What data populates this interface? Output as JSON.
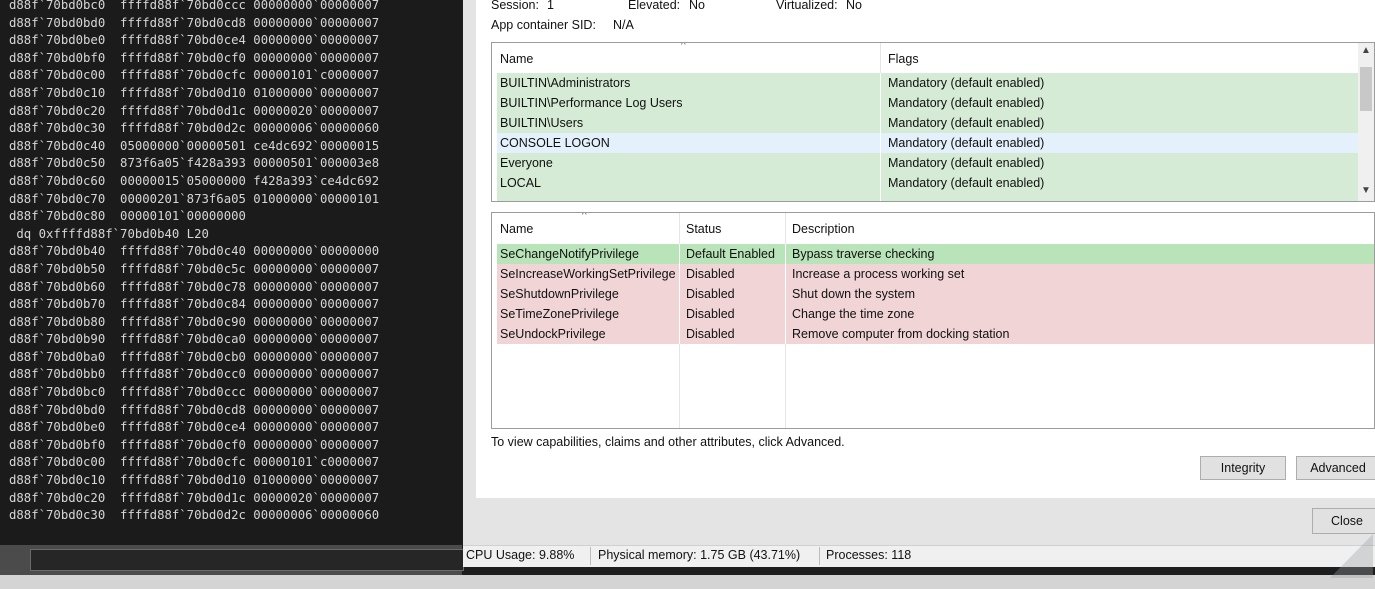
{
  "console": {
    "lines": [
      "d88f`70bd0bc0  ffffd88f`70bd0ccc 00000000`00000007",
      "d88f`70bd0bd0  ffffd88f`70bd0cd8 00000000`00000007",
      "d88f`70bd0be0  ffffd88f`70bd0ce4 00000000`00000007",
      "d88f`70bd0bf0  ffffd88f`70bd0cf0 00000000`00000007",
      "d88f`70bd0c00  ffffd88f`70bd0cfc 00000101`c0000007",
      "d88f`70bd0c10  ffffd88f`70bd0d10 01000000`00000007",
      "d88f`70bd0c20  ffffd88f`70bd0d1c 00000020`00000007",
      "d88f`70bd0c30  ffffd88f`70bd0d2c 00000006`00000060",
      "d88f`70bd0c40  05000000`00000501 ce4dc692`00000015",
      "d88f`70bd0c50  873f6a05`f428a393 00000501`000003e8",
      "d88f`70bd0c60  00000015`05000000 f428a393`ce4dc692",
      "d88f`70bd0c70  00000201`873f6a05 01000000`00000101",
      "d88f`70bd0c80  00000101`00000000",
      " dq 0xffffd88f`70bd0b40 L20",
      "d88f`70bd0b40  ffffd88f`70bd0c40 00000000`00000000",
      "d88f`70bd0b50  ffffd88f`70bd0c5c 00000000`00000007",
      "d88f`70bd0b60  ffffd88f`70bd0c78 00000000`00000007",
      "d88f`70bd0b70  ffffd88f`70bd0c84 00000000`00000007",
      "d88f`70bd0b80  ffffd88f`70bd0c90 00000000`00000007",
      "d88f`70bd0b90  ffffd88f`70bd0ca0 00000000`00000007",
      "d88f`70bd0ba0  ffffd88f`70bd0cb0 00000000`00000007",
      "d88f`70bd0bb0  ffffd88f`70bd0cc0 00000000`00000007",
      "d88f`70bd0bc0  ffffd88f`70bd0ccc 00000000`00000007",
      "d88f`70bd0bd0  ffffd88f`70bd0cd8 00000000`00000007",
      "d88f`70bd0be0  ffffd88f`70bd0ce4 00000000`00000007",
      "d88f`70bd0bf0  ffffd88f`70bd0cf0 00000000`00000007",
      "d88f`70bd0c00  ffffd88f`70bd0cfc 00000101`c0000007",
      "d88f`70bd0c10  ffffd88f`70bd0d10 01000000`00000007",
      "d88f`70bd0c20  ffffd88f`70bd0d1c 00000020`00000007",
      "d88f`70bd0c30  ffffd88f`70bd0d2c 00000006`00000060"
    ]
  },
  "dialog": {
    "session_label": "Session:",
    "session_value": "1",
    "elevated_label": "Elevated:",
    "elevated_value": "No",
    "virtualized_label": "Virtualized:",
    "virtualized_value": "No",
    "appcontainer_label": "App container SID:",
    "appcontainer_value": "N/A",
    "groups": {
      "headers": [
        "Name",
        "Flags"
      ],
      "rows": [
        {
          "name": "BUILTIN\\Administrators",
          "flags": "Mandatory (default enabled)"
        },
        {
          "name": "BUILTIN\\Performance Log Users",
          "flags": "Mandatory (default enabled)"
        },
        {
          "name": "BUILTIN\\Users",
          "flags": "Mandatory (default enabled)"
        },
        {
          "name": "CONSOLE LOGON",
          "flags": "Mandatory (default enabled)"
        },
        {
          "name": "Everyone",
          "flags": "Mandatory (default enabled)"
        },
        {
          "name": "LOCAL",
          "flags": "Mandatory (default enabled)"
        }
      ]
    },
    "privileges": {
      "headers": [
        "Name",
        "Status",
        "Description"
      ],
      "rows": [
        {
          "name": "SeChangeNotifyPrivilege",
          "status": "Default Enabled",
          "description": "Bypass traverse checking"
        },
        {
          "name": "SeIncreaseWorkingSetPrivilege",
          "status": "Disabled",
          "description": "Increase a process working set"
        },
        {
          "name": "SeShutdownPrivilege",
          "status": "Disabled",
          "description": "Shut down the system"
        },
        {
          "name": "SeTimeZonePrivilege",
          "status": "Disabled",
          "description": "Change the time zone"
        },
        {
          "name": "SeUndockPrivilege",
          "status": "Disabled",
          "description": "Remove computer from docking station"
        }
      ]
    },
    "hint": "To view capabilities, claims and other attributes, click Advanced.",
    "integrity_button": "Integrity",
    "advanced_button": "Advanced",
    "close_button": "Close"
  },
  "statusbar": {
    "cpu": "CPU Usage: 9.88%",
    "memory": "Physical memory: 1.75 GB (43.71%)",
    "processes": "Processes: 118"
  },
  "colors": {
    "enabled_row": "#d5ebd5",
    "selected_row": "#e4f0fb",
    "disabled_row": "#f0d4d6",
    "console_bg": "#1b1b1b"
  }
}
